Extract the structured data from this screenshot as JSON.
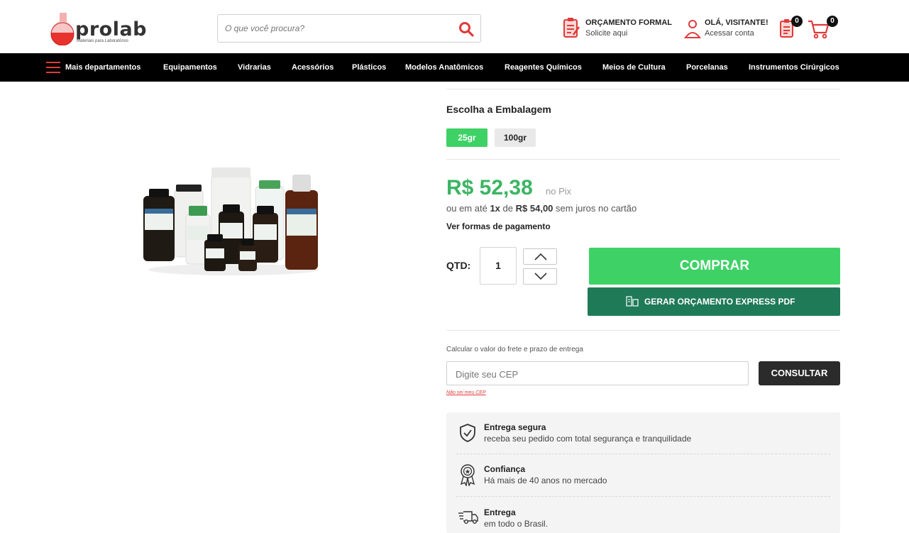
{
  "brand": {
    "name": "prolab",
    "tagline": "Materiais para Laboratórios"
  },
  "search": {
    "placeholder": "O que você procura?"
  },
  "header": {
    "quote": {
      "title": "ORÇAMENTO FORMAL",
      "subtitle": "Solicite aqui"
    },
    "account": {
      "title": "OLÁ, VISITANTE!",
      "subtitle": "Acessar conta"
    },
    "list_count": "0",
    "cart_count": "0"
  },
  "nav": {
    "menu_label": "Mais departamentos",
    "items": [
      "Equipamentos",
      "Vidrarias",
      "Acessórios",
      "Plásticos",
      "Modelos Anatômicos",
      "Reagentes Químicos",
      "Meios de Cultura",
      "Porcelanas",
      "Instrumentos Cirúrgicos"
    ]
  },
  "product": {
    "packaging_title": "Escolha a Embalagem",
    "options": [
      "25gr",
      "100gr"
    ],
    "selected_option": "25gr",
    "price": "R$ 52,38",
    "price_suffix": "no Pix",
    "install_prefix": "ou em até",
    "install_count": "1x",
    "install_of": "de",
    "install_value": "R$ 54,00",
    "install_suffix": "sem juros no cartão",
    "payment_link": "Ver formas de pagamento",
    "qty_label": "QTD:",
    "qty_value": "1",
    "buy_label": "COMPRAR",
    "quote_label": "GERAR ORÇAMENTO EXPRESS PDF"
  },
  "shipping": {
    "title": "Calcular o valor do frete e prazo de entrega",
    "placeholder": "Digite seu CEP",
    "button": "CONSULTAR",
    "help_link": "Não sei meu CEP"
  },
  "features": [
    {
      "icon": "shield-check-icon",
      "title": "Entrega segura",
      "desc": "receba seu pedido com total segurança e tranquilidade"
    },
    {
      "icon": "award-icon",
      "title": "Confiança",
      "desc": "Há mais de 40 anos no mercado"
    },
    {
      "icon": "truck-icon",
      "title": "Entrega",
      "desc": "em todo o Brasil."
    }
  ],
  "colors": {
    "accent_green": "#3ed266",
    "price_green": "#3cb563",
    "quote_green": "#1f7a58",
    "brand_red": "#e03a3a",
    "nav_bg": "#000000"
  }
}
